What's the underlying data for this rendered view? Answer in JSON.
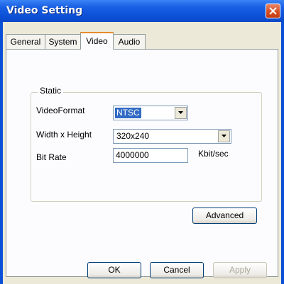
{
  "window": {
    "title": "Video Setting"
  },
  "tabs": [
    {
      "label": "General",
      "active": false
    },
    {
      "label": "System",
      "active": false
    },
    {
      "label": "Video",
      "active": true
    },
    {
      "label": "Audio",
      "active": false
    }
  ],
  "video_tab": {
    "group_label": "Static",
    "video_format": {
      "label": "VideoFormat",
      "value": "NTSC"
    },
    "resolution": {
      "label": "Width x Height",
      "value": "320x240"
    },
    "bit_rate": {
      "label": "Bit Rate",
      "value": "4000000",
      "unit": "Kbit/sec"
    },
    "advanced_label": "Advanced"
  },
  "footer": {
    "ok_label": "OK",
    "cancel_label": "Cancel",
    "apply_label": "Apply"
  },
  "colors": {
    "title_bar": "#0a4fd8",
    "dialog_bg": "#ece9d8",
    "selection": "#316ac5",
    "active_tab_accent": "#e68b2c"
  }
}
